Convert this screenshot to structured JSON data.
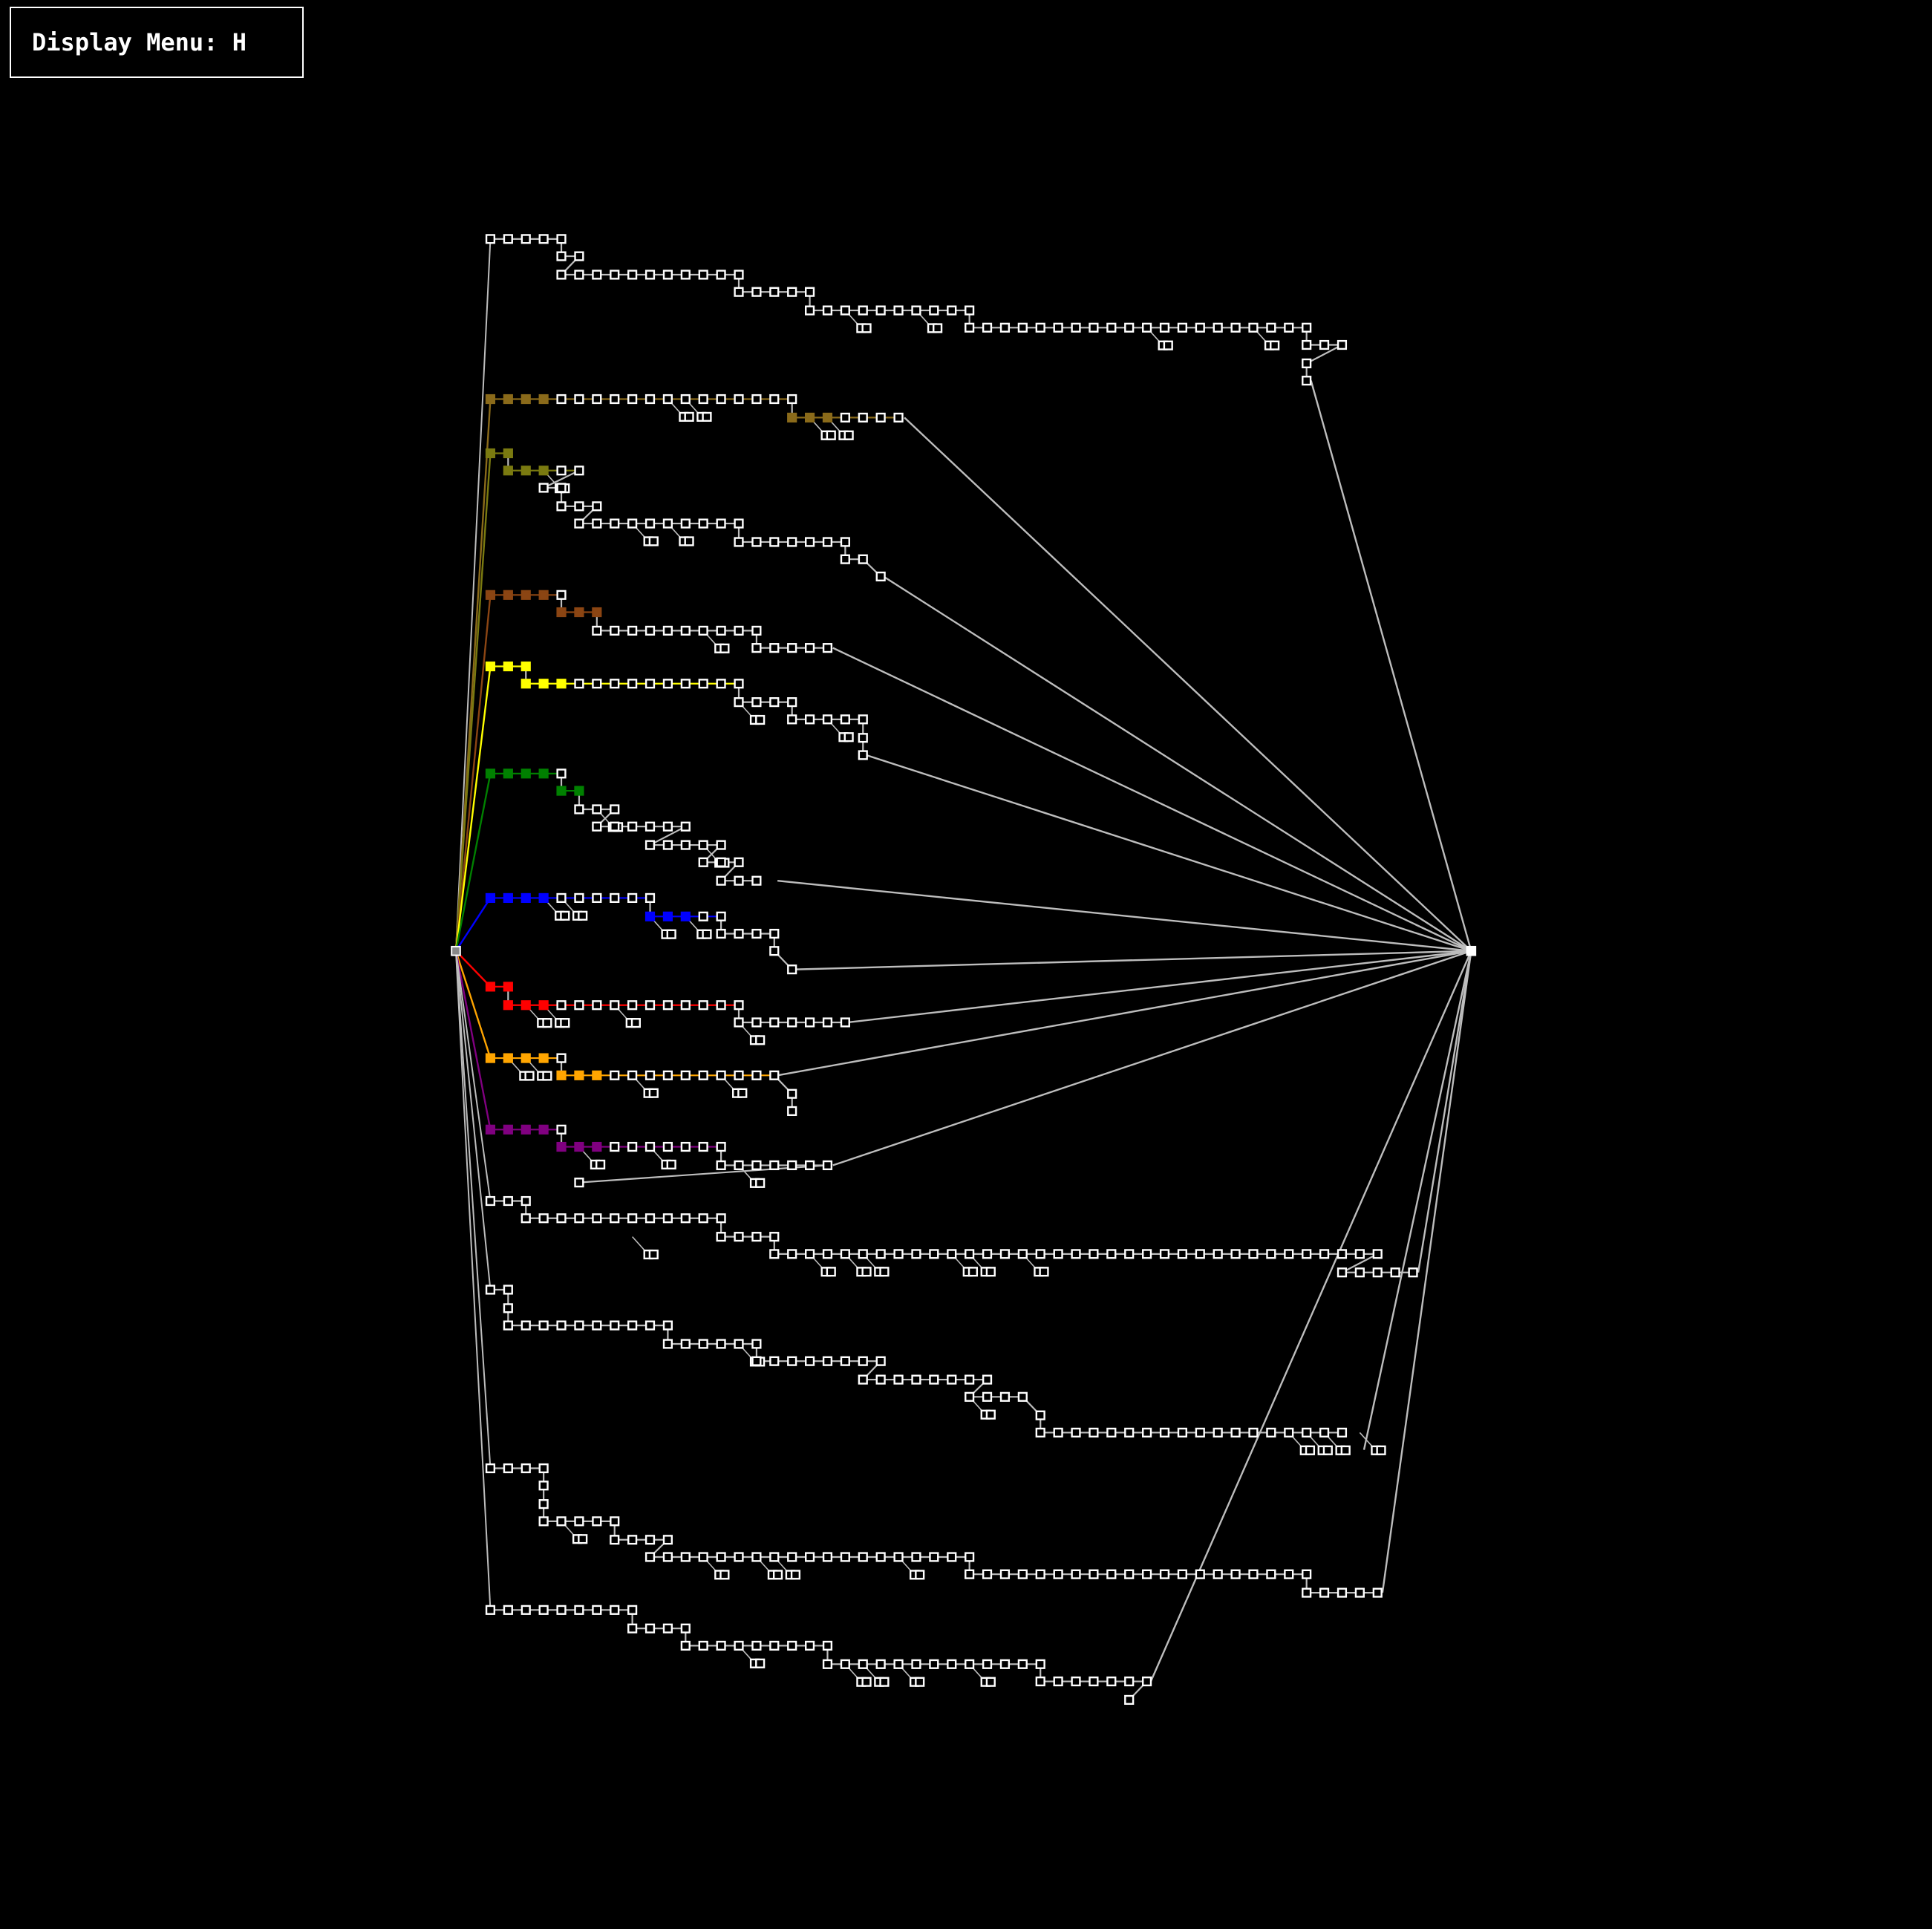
{
  "menu": {
    "label": "Display Menu: H"
  },
  "colors": {
    "background": "#000000",
    "default": "#bdbdbd",
    "highlight_paths": [
      "#8a6a1a",
      "#7a7a10",
      "#8b4513",
      "#ffff00",
      "#008000",
      "#0000ff",
      "#ff0000",
      "#ffa500",
      "#800080"
    ]
  },
  "graph": {
    "source_node": "source",
    "sink_node": "sink",
    "branch_count": 14,
    "highlighted_branch_count": 9
  }
}
